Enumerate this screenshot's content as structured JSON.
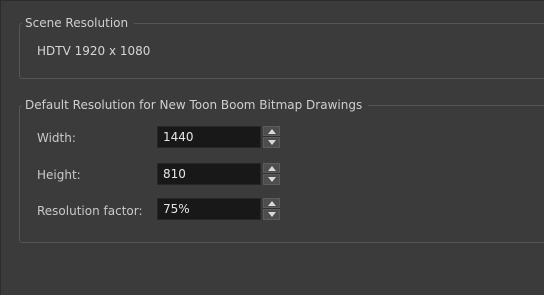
{
  "scene_resolution": {
    "title": "Scene Resolution",
    "value": "HDTV  1920 x 1080"
  },
  "default_resolution": {
    "title": "Default Resolution for New Toon Boom Bitmap Drawings",
    "fields": [
      {
        "label": "Width:",
        "value": "1440"
      },
      {
        "label": "Height:",
        "value": "810"
      },
      {
        "label": "Resolution factor:",
        "value": "75%"
      }
    ]
  },
  "icons": {
    "spin_up": "triangle-up-icon",
    "spin_down": "triangle-down-icon"
  }
}
